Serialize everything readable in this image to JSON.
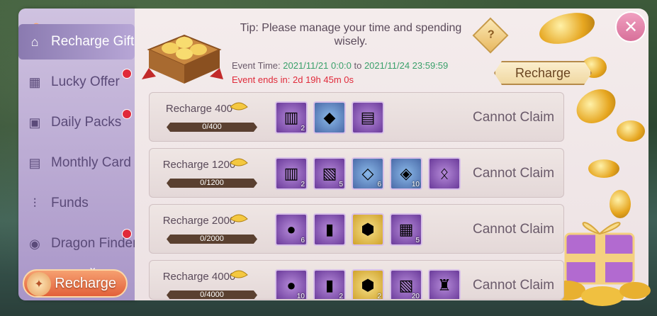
{
  "sidebar": {
    "items": [
      {
        "label": "Recharge Gift",
        "icon": "gift-icon",
        "active": true,
        "dot": false
      },
      {
        "label": "Lucky Offer",
        "icon": "offer-icon",
        "active": false,
        "dot": true
      },
      {
        "label": "Daily Packs",
        "icon": "pack-icon",
        "active": false,
        "dot": true
      },
      {
        "label": "Monthly Card",
        "icon": "card-icon",
        "active": false,
        "dot": false
      },
      {
        "label": "Funds",
        "icon": "chart-icon",
        "active": false,
        "dot": false
      },
      {
        "label": "Dragon Finder",
        "icon": "dragon-icon",
        "active": false,
        "dot": true
      }
    ],
    "recharge_label": "Recharge"
  },
  "header": {
    "tip": "Tip: Please manage your time and spending wisely.",
    "event_time_label": "Event Time: ",
    "event_start": "2021/11/21 0:0:0",
    "event_to": " to ",
    "event_end": "2021/11/24 23:59:59",
    "event_ends_in": "Event ends in: 2d 19h 45m 0s",
    "recharge_button": "Recharge",
    "help_symbol": "?"
  },
  "rows": [
    {
      "title": "Recharge 400",
      "progress": "0/400",
      "status": "Cannot Claim",
      "items": [
        {
          "icon": "chest-icon",
          "style": "purple",
          "count": "2"
        },
        {
          "icon": "gem-icon",
          "style": "blue",
          "count": ""
        },
        {
          "icon": "treasure-chest-icon",
          "style": "purple",
          "count": ""
        }
      ]
    },
    {
      "title": "Recharge 1200",
      "progress": "0/1200",
      "status": "Cannot Claim",
      "items": [
        {
          "icon": "chest-icon",
          "style": "purple",
          "count": "2"
        },
        {
          "icon": "scroll-icon",
          "style": "purple",
          "count": "5"
        },
        {
          "icon": "crystal-icon",
          "style": "blue",
          "count": "6"
        },
        {
          "icon": "amber-icon",
          "style": "blue",
          "count": "10"
        },
        {
          "icon": "necklace-icon",
          "style": "purple",
          "count": ""
        }
      ]
    },
    {
      "title": "Recharge 2000",
      "progress": "0/2000",
      "status": "Cannot Claim",
      "items": [
        {
          "icon": "orb-icon",
          "style": "purple",
          "count": "6"
        },
        {
          "icon": "book-icon",
          "style": "purple",
          "count": ""
        },
        {
          "icon": "ore-icon",
          "style": "gold",
          "count": ""
        },
        {
          "icon": "chest-open-icon",
          "style": "purple",
          "count": "5"
        }
      ]
    },
    {
      "title": "Recharge 4000",
      "progress": "0/4000",
      "status": "Cannot Claim",
      "items": [
        {
          "icon": "orb-icon",
          "style": "purple",
          "count": "10"
        },
        {
          "icon": "book-icon",
          "style": "purple",
          "count": "2"
        },
        {
          "icon": "ore-icon",
          "style": "gold",
          "count": "2"
        },
        {
          "icon": "scroll-icon",
          "style": "purple",
          "count": "20"
        },
        {
          "icon": "armor-icon",
          "style": "purple",
          "count": ""
        }
      ]
    }
  ],
  "colors": {
    "accent": "#e02a3a",
    "green": "#3aa06a",
    "panel": "#f4ecec"
  }
}
